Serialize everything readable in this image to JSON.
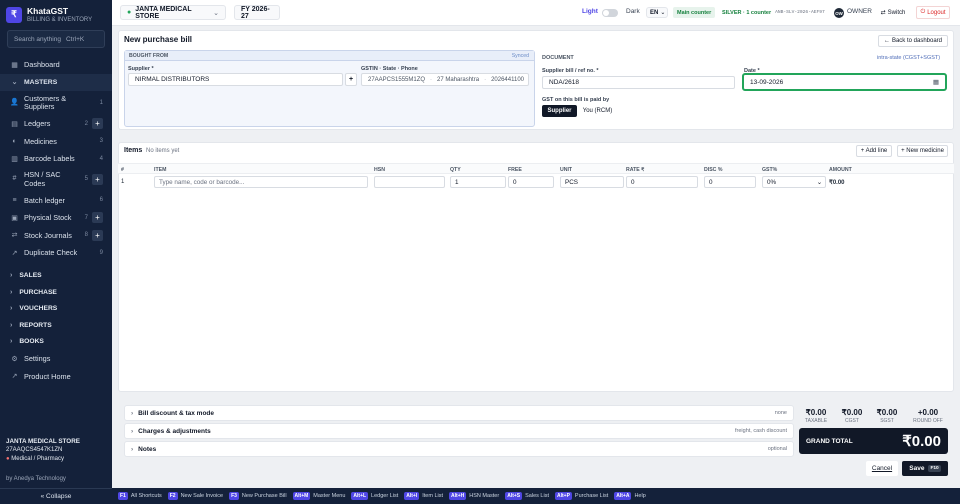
{
  "app": {
    "logo": "₹",
    "name": "KhataGST",
    "subtitle": "BILLING & INVENTORY"
  },
  "search": {
    "placeholder": "Search anything",
    "shortcut": "Ctrl+K"
  },
  "sidebar": {
    "items": [
      {
        "label": "Dashboard",
        "icon": "grid-icon"
      },
      {
        "label": "MASTERS",
        "icon": ""
      },
      {
        "label": "Customers & Suppliers",
        "count": "1",
        "icon": "users-icon"
      },
      {
        "label": "Ledgers",
        "count": "2",
        "plus": "+",
        "icon": "book-icon"
      },
      {
        "label": "Medicines",
        "count": "3",
        "icon": "pill-icon"
      },
      {
        "label": "Barcode Labels",
        "count": "4",
        "icon": "tag-icon"
      },
      {
        "label": "HSN / SAC Codes",
        "count": "5",
        "plus": "+",
        "icon": "hash-icon"
      },
      {
        "label": "Batch ledger",
        "count": "6",
        "icon": "layers-icon"
      },
      {
        "label": "Physical Stock",
        "count": "7",
        "plus": "+",
        "icon": "box-icon"
      },
      {
        "label": "Stock Journals",
        "count": "8",
        "plus": "+",
        "icon": "swap-icon"
      },
      {
        "label": "Duplicate Check",
        "count": "9",
        "icon": "check-icon"
      }
    ],
    "sections": [
      "SALES",
      "PURCHASE",
      "VOUCHERS",
      "REPORTS",
      "BOOKS"
    ],
    "settings": "Settings",
    "product_home": "Product Home",
    "footer": {
      "store": "JANTA MEDICAL STORE",
      "gstin": "27AAQCS4547K1ZN",
      "type": "Medical / Pharmacy",
      "by": "by Anedya Technology",
      "collapse": "« Collapse"
    }
  },
  "topbar": {
    "store": "JANTA MEDICAL STORE",
    "fy": "FY 2026-27",
    "light": "Light",
    "dark": "Dark",
    "lang": "EN",
    "counter": "Main counter",
    "plan": "SILVER · 1 counter",
    "license": "ANB-SLV-2026-AEF97",
    "avatar": "OW",
    "role": "OWNER",
    "switch": "Switch",
    "logout": "Logout"
  },
  "form": {
    "title": "New purchase bill",
    "back": "Back to dashboard",
    "bought_from": "BOUGHT FROM",
    "synced": "Synced",
    "supplier_label": "Supplier *",
    "supplier": "NIRMAL DISTRIBUTORS",
    "gstin_label": "GSTIN · State · Phone",
    "gstin": "27AAPCS1555M1ZQ",
    "state": "27 Maharashtra",
    "phone": "2026441100",
    "document": "DOCUMENT",
    "tax_mode": "intra-state (CGST+SGST)",
    "bill_label": "Supplier bill / ref no. *",
    "bill": "NDA/2618",
    "date_label": "Date *",
    "date": "13-09-2026",
    "paid_by": "GST on this bill is paid by",
    "paid_supplier": "Supplier",
    "paid_you": "You (RCM)"
  },
  "items": {
    "title": "Items",
    "empty": "No items yet",
    "add_line": "+ Add line",
    "new_medicine": "+ New medicine",
    "headers": [
      "#",
      "ITEM",
      "HSN",
      "QTY",
      "FREE",
      "UNIT",
      "RATE ₹",
      "DISC %",
      "GST%",
      "AMOUNT"
    ],
    "row": {
      "n": "1",
      "placeholder": "Type name, code or barcode...",
      "qty": "1",
      "free": "0",
      "unit": "PCS",
      "rate": "0",
      "disc": "0",
      "gst": "0%",
      "amount": "₹0.00"
    }
  },
  "sections": [
    {
      "label": "Bill discount & tax mode",
      "hint": "none"
    },
    {
      "label": "Charges & adjustments",
      "hint": "freight, cash discount"
    },
    {
      "label": "Notes",
      "hint": "optional"
    }
  ],
  "totals": [
    {
      "value": "₹0.00",
      "label": "TAXABLE"
    },
    {
      "value": "₹0.00",
      "label": "CGST"
    },
    {
      "value": "₹0.00",
      "label": "SGST"
    },
    {
      "value": "+0.00",
      "label": "ROUND OFF"
    }
  ],
  "grand": {
    "label": "GRAND TOTAL",
    "value": "₹0.00"
  },
  "actions": {
    "cancel": "Cancel",
    "save": "Save",
    "save_key": "F10"
  },
  "shortcuts": [
    {
      "key": "F1",
      "label": "All Shortcuts"
    },
    {
      "key": "F2",
      "label": "New Sale Invoice"
    },
    {
      "key": "F3",
      "label": "New Purchase Bill"
    },
    {
      "key": "Alt+M",
      "label": "Master Menu"
    },
    {
      "key": "Alt+L",
      "label": "Ledger List"
    },
    {
      "key": "Alt+I",
      "label": "Item List"
    },
    {
      "key": "Alt+H",
      "label": "HSN Master"
    },
    {
      "key": "Alt+S",
      "label": "Sales List"
    },
    {
      "key": "Alt+P",
      "label": "Purchase List"
    },
    {
      "key": "Alt+A",
      "label": "Help"
    }
  ],
  "colors": {
    "sidebar": "#14213a",
    "accent": "#4f46e5",
    "date_focus": "#22a55a",
    "dark_button": "#111827",
    "logout": "#dc2626"
  }
}
